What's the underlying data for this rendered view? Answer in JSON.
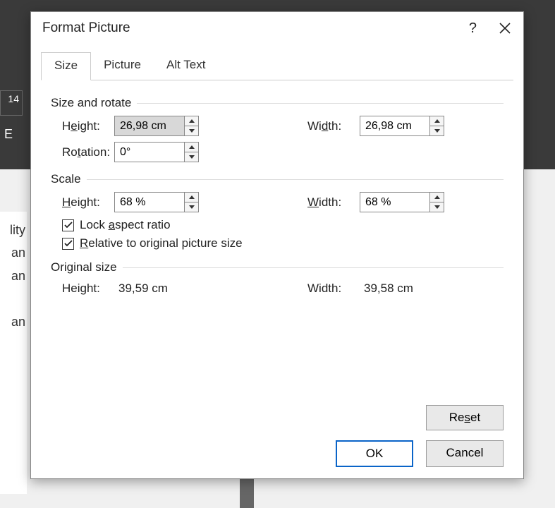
{
  "dialog": {
    "title": "Format Picture",
    "tabs": [
      "Size",
      "Picture",
      "Alt Text"
    ],
    "active_tab": 0,
    "sections": {
      "size_rotate": {
        "label": "Size and rotate",
        "height_label": "Height:",
        "height_value": "26,98 cm",
        "width_label": "Width:",
        "width_value": "26,98 cm",
        "rotation_label": "Rotation:",
        "rotation_value": "0°"
      },
      "scale": {
        "label": "Scale",
        "height_label": "Height:",
        "height_value": "68 %",
        "width_label": "Width:",
        "width_value": "68 %",
        "lock_aspect_label": "Lock aspect ratio",
        "lock_aspect_checked": true,
        "relative_label": "Relative to original picture size",
        "relative_checked": true
      },
      "original": {
        "label": "Original size",
        "height_label": "Height:",
        "height_value": "39,59 cm",
        "width_label": "Width:",
        "width_value": "39,58 cm"
      }
    },
    "buttons": {
      "reset": "Reset",
      "ok": "OK",
      "cancel": "Cancel"
    }
  },
  "background": {
    "slot": "14",
    "col_letter": "E",
    "side_text": [
      "lity",
      "an",
      "an",
      "",
      "an"
    ]
  }
}
